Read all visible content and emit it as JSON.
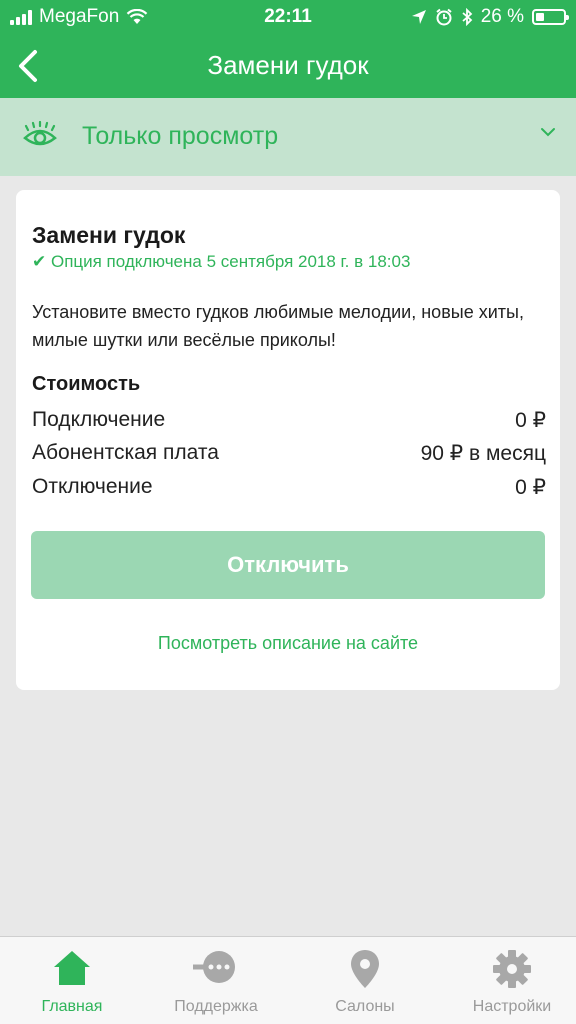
{
  "status_bar": {
    "carrier": "MegaFon",
    "time": "22:11",
    "battery": "26 %"
  },
  "nav": {
    "title": "Замени гудок",
    "back_icon": "chevron-left-icon"
  },
  "mode": {
    "label": "Только просмотр",
    "icon": "eye-icon"
  },
  "card": {
    "title": "Замени гудок",
    "status": "✔ Опция подключена 5 сентября 2018 г. в 18:03",
    "description": "Установите вместо гудков любимые мелодии, новые хиты, милые шутки или весёлые приколы!",
    "cost_title": "Стоимость",
    "costs": [
      {
        "name": "Подключение",
        "value": "0 ₽"
      },
      {
        "name": "Абонентская плата",
        "value": "90 ₽ в месяц"
      },
      {
        "name": "Отключение",
        "value": "0 ₽"
      }
    ],
    "disconnect_label": "Отключить",
    "site_link": "Посмотреть описание на сайте"
  },
  "tabs": [
    {
      "label": "Главная",
      "icon": "home-icon",
      "active": true
    },
    {
      "label": "Поддержка",
      "icon": "chat-icon",
      "active": false
    },
    {
      "label": "Салоны",
      "icon": "location-pin-icon",
      "active": false
    },
    {
      "label": "Настройки",
      "icon": "gear-icon",
      "active": false
    }
  ],
  "colors": {
    "accent": "#2fb45a",
    "mode_bar": "#c4e3cf",
    "button_disabled": "#9bd7b3",
    "tab_inactive": "#9a9a9a"
  }
}
